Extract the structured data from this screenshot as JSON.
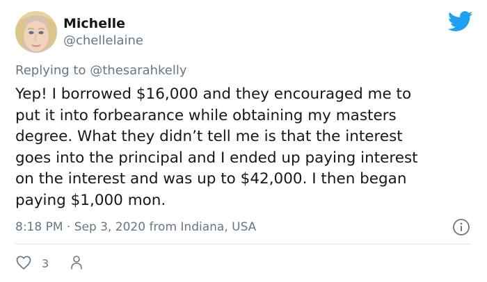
{
  "author": {
    "name": "Michelle",
    "handle": "@chellelaine"
  },
  "reply": {
    "prefix": "Replying to",
    "mention": "@thesarahkelly"
  },
  "body_lines": [
    "Yep! I borrowed $16,000 and they encouraged me to",
    "put it into forbearance while obtaining my masters",
    "degree. What they didn’t tell me is that the interest",
    "goes into the principal and I ended up paying interest",
    "on the interest and was up to $42,000. I then began",
    "paying $1,000 mon."
  ],
  "meta": {
    "text": "8:18 PM · Sep 3, 2020 from Indiana, USA"
  },
  "actions": {
    "like_count": "3"
  },
  "colors": {
    "twitter_blue": "#1da1f2",
    "secondary_text": "#657786",
    "primary_text": "#14171a",
    "divider": "#e1e8ed"
  },
  "icons": [
    "twitter-bird-icon",
    "info-icon",
    "heart-icon",
    "person-icon"
  ]
}
